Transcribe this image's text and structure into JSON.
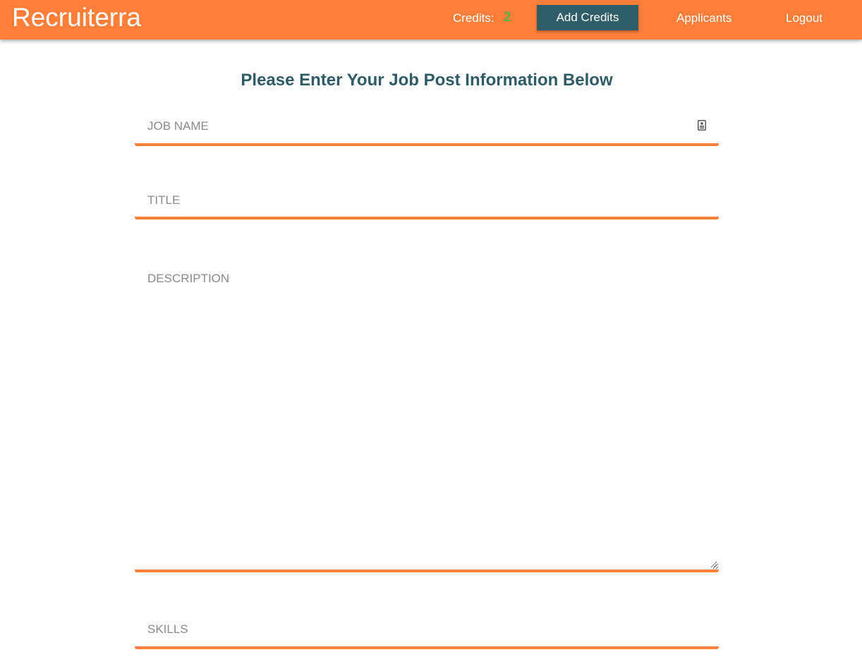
{
  "header": {
    "brand": "Recruiterra",
    "credits_label": "Credits:",
    "credits_count": "2",
    "add_credits_label": "Add Credits",
    "nav": {
      "applicants": "Applicants",
      "logout": "Logout"
    },
    "colors": {
      "bar": "#fe7e3a",
      "button": "#2f5e68",
      "credits_count": "#58b145"
    }
  },
  "form": {
    "heading": "Please Enter Your Job Post Information Below",
    "job_name": {
      "placeholder": "JOB NAME",
      "value": "",
      "icon": "contact-card-icon"
    },
    "title": {
      "placeholder": "TITLE",
      "value": ""
    },
    "description": {
      "placeholder": "DESCRIPTION",
      "value": ""
    },
    "skills": {
      "placeholder": "SKILLS",
      "value": ""
    },
    "colors": {
      "underline": "#fe7e3a",
      "heading": "#2e5b66"
    }
  }
}
